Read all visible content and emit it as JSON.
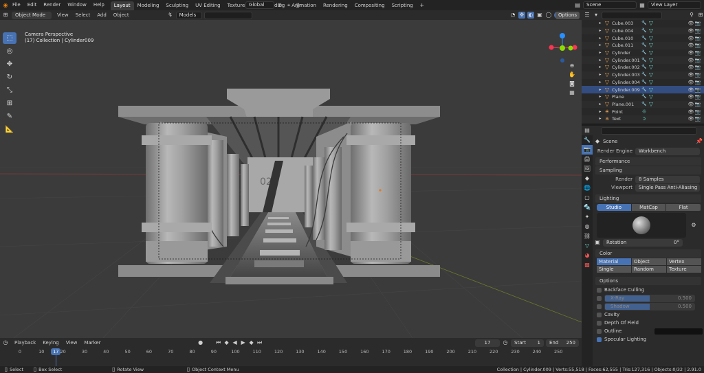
{
  "menu": [
    "File",
    "Edit",
    "Render",
    "Window",
    "Help"
  ],
  "workspaces": [
    "Layout",
    "Modeling",
    "Sculpting",
    "UV Editing",
    "Texture Paint",
    "Shading",
    "Animation",
    "Rendering",
    "Compositing",
    "Scripting"
  ],
  "active_workspace": "Layout",
  "scene_name": "Scene",
  "view_layer": "View Layer",
  "transform": {
    "orientation": "Global",
    "options": "Options"
  },
  "viewport_header": {
    "mode": "Object Mode",
    "menus": [
      "View",
      "Select",
      "Add",
      "Object"
    ],
    "models": "Models"
  },
  "overlay_text": {
    "camera": "Camera Perspective",
    "collection": "(17) Collection | Cylinder009"
  },
  "outliner": [
    {
      "name": "Cube.003",
      "type": "mesh"
    },
    {
      "name": "Cube.004",
      "type": "mesh"
    },
    {
      "name": "Cube.010",
      "type": "mesh"
    },
    {
      "name": "Cube.011",
      "type": "mesh"
    },
    {
      "name": "Cylinder",
      "type": "mesh"
    },
    {
      "name": "Cylinder.001",
      "type": "mesh"
    },
    {
      "name": "Cylinder.002",
      "type": "mesh"
    },
    {
      "name": "Cylinder.003",
      "type": "mesh"
    },
    {
      "name": "Cylinder.004",
      "type": "mesh"
    },
    {
      "name": "Cylinder.009",
      "type": "mesh",
      "selected": true
    },
    {
      "name": "Plane",
      "type": "mesh"
    },
    {
      "name": "Plane.001",
      "type": "mesh"
    },
    {
      "name": "Point",
      "type": "light"
    },
    {
      "name": "Text",
      "type": "text"
    }
  ],
  "properties": {
    "context": "Scene",
    "render_engine_label": "Render Engine",
    "render_engine": "Workbench",
    "performance": "Performance",
    "sampling": "Sampling",
    "render_label": "Render",
    "render_samples": "8 Samples",
    "viewport_label": "Viewport",
    "viewport_aa": "Single Pass Anti-Aliasing",
    "lighting": "Lighting",
    "lighting_modes": [
      "Studio",
      "MatCap",
      "Flat"
    ],
    "rotation_label": "Rotation",
    "rotation_value": "0°",
    "color": "Color",
    "color_modes": [
      "Material",
      "Object",
      "Vertex",
      "Single",
      "Random",
      "Texture"
    ],
    "options": "Options",
    "backface": "Backface Culling",
    "xray_label": "X-Ray",
    "xray_value": "0.500",
    "shadow_label": "Shadow",
    "shadow_value": "0.500",
    "cavity": "Cavity",
    "dof": "Depth Of Field",
    "outline": "Outline",
    "specular": "Specular Lighting"
  },
  "timeline": {
    "menus": [
      "Playback",
      "Keying",
      "View",
      "Marker"
    ],
    "current_frame": "17",
    "start_label": "Start",
    "start": "1",
    "end_label": "End",
    "end": "250",
    "ticks": [
      "0",
      "10",
      "20",
      "30",
      "40",
      "50",
      "60",
      "70",
      "80",
      "90",
      "100",
      "110",
      "120",
      "130",
      "140",
      "150",
      "160",
      "170",
      "180",
      "190",
      "200",
      "210",
      "220",
      "230",
      "240",
      "250"
    ],
    "playhead": "17"
  },
  "status": {
    "select": "Select",
    "box_select": "Box Select",
    "rotate": "Rotate View",
    "context_menu": "Object Context Menu",
    "stats": "Collection | Cylinder.009 | Verts:55,518 | Faces:62,555 | Tris:127,316 | Objects:0/32 | 2.91.0"
  },
  "colors": {
    "accent": "#4772b3",
    "mesh_icon": "#e5a050",
    "data_icon": "#6ad0c0",
    "x_axis": "#ff3352",
    "y_axis": "#8bdc00",
    "z_axis": "#2890ff"
  }
}
